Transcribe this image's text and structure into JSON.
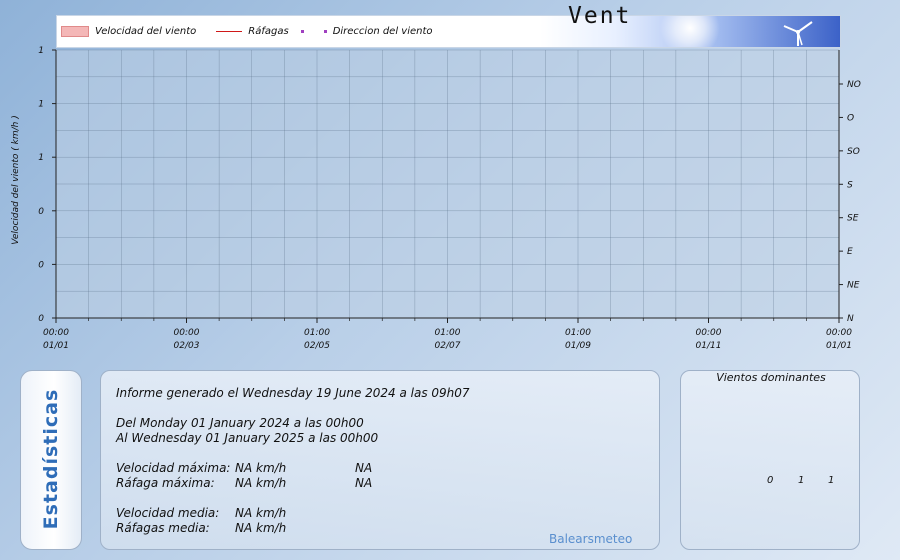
{
  "legend": {
    "speed": "Velocidad del viento",
    "gusts": "Ráfagas",
    "direction": "Direccion del viento",
    "title": "Vent"
  },
  "colors": {
    "speed_fill": "#f4b7b7",
    "gust_line": "#d01818",
    "direction_dot": "#a040c0",
    "accent": "#2f6db8"
  },
  "chart_data": {
    "type": "line",
    "ylabel": "Velocidad del viento  ( km/h )",
    "y_ticks": [
      "1",
      "1",
      "1",
      "0",
      "0",
      "0"
    ],
    "y2_ticks": [
      "NO",
      "O",
      "SO",
      "S",
      "SE",
      "E",
      "NE",
      "N"
    ],
    "x_ticks": [
      {
        "time": "00:00",
        "date": "01/01"
      },
      {
        "time": "00:00",
        "date": "02/03"
      },
      {
        "time": "01:00",
        "date": "02/05"
      },
      {
        "time": "01:00",
        "date": "02/07"
      },
      {
        "time": "01:00",
        "date": "01/09"
      },
      {
        "time": "00:00",
        "date": "01/11"
      },
      {
        "time": "00:00",
        "date": "01/01"
      }
    ],
    "series": [
      {
        "name": "Velocidad del viento",
        "values": []
      },
      {
        "name": "Ráfagas",
        "values": []
      },
      {
        "name": "Direccion del viento",
        "values": []
      }
    ],
    "grid": true
  },
  "stats": {
    "label": "Estadísticas",
    "report": "Informe generado el Wednesday 19 June 2024 a las 09h07",
    "from": "Del Monday 01 January 2024 a las 00h00",
    "to": "Al Wednesday 01 January 2025 a las 00h00",
    "rows": [
      {
        "label": "Velocidad máxima:",
        "value": "NA km/h",
        "extra": "NA"
      },
      {
        "label": "Ráfaga máxima:",
        "value": "NA km/h",
        "extra": "NA"
      },
      {
        "label": "Velocidad media:",
        "value": "NA km/h",
        "extra": ""
      },
      {
        "label": "Ráfagas media:",
        "value": "NA km/h",
        "extra": ""
      }
    ],
    "station": "Balearsmeteo"
  },
  "dominant": {
    "title": "Vientos dominantes",
    "values": [
      "0",
      "1",
      "1"
    ]
  }
}
